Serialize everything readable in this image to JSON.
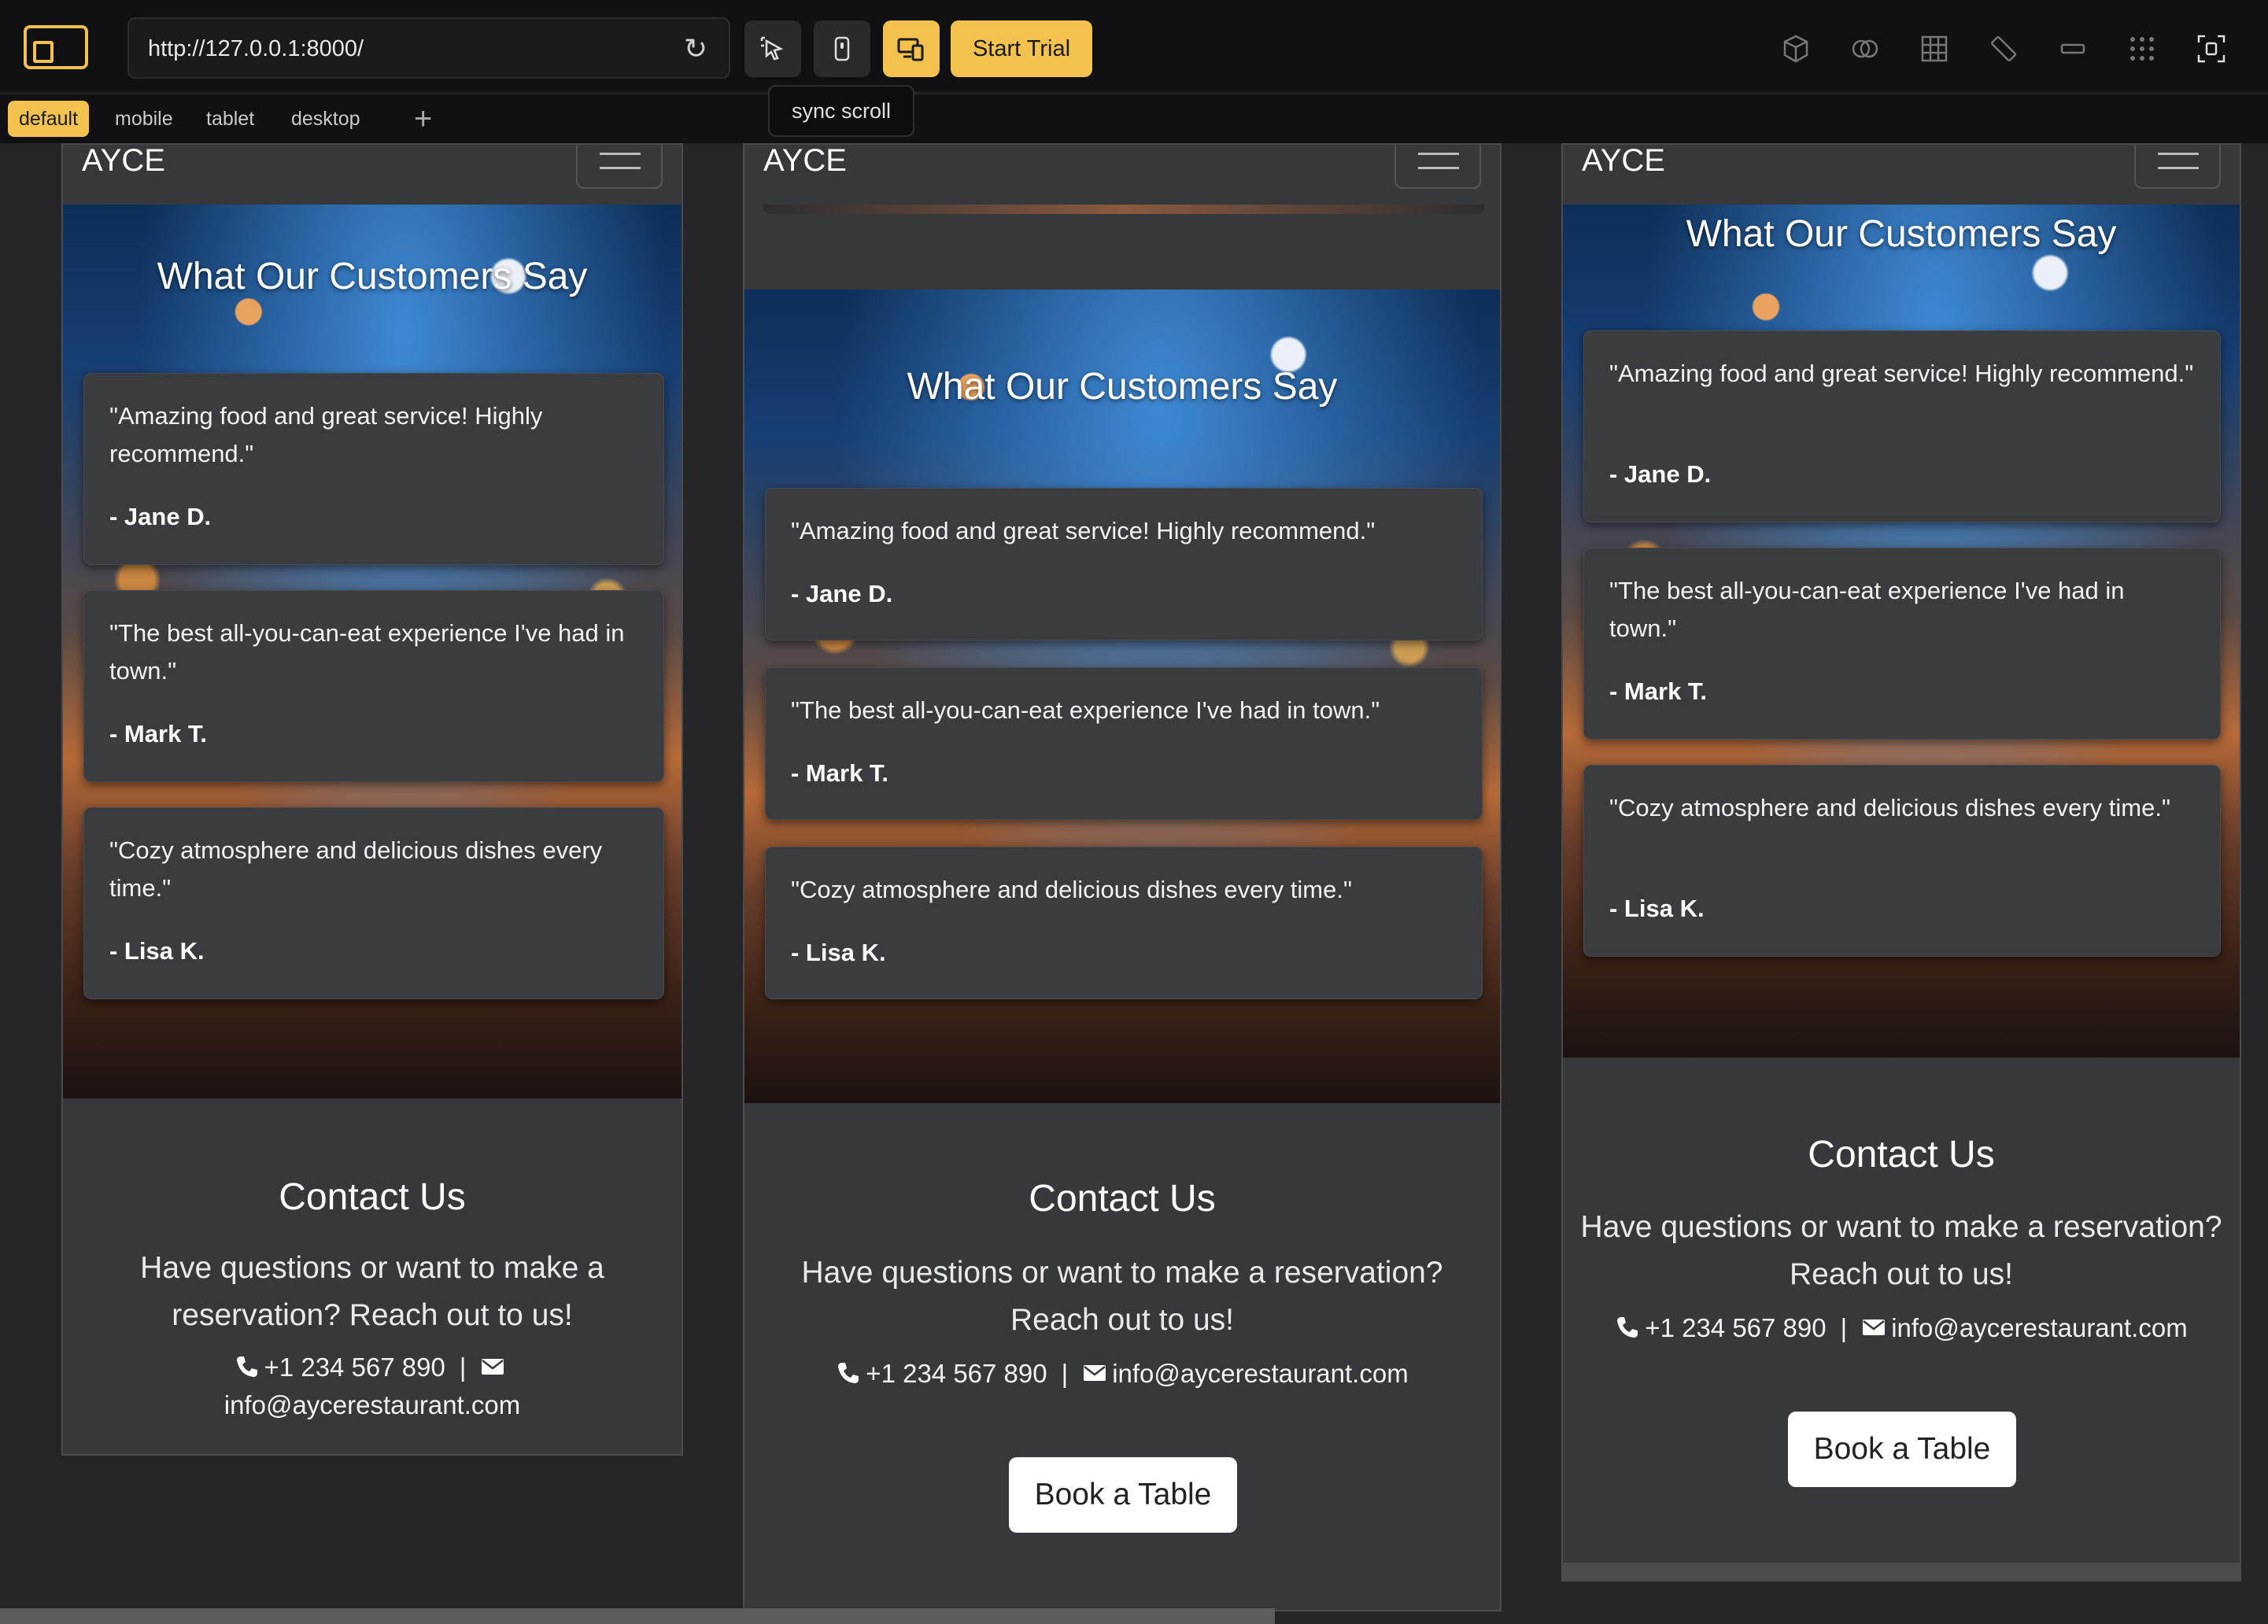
{
  "toolbar": {
    "url": "http://127.0.0.1:8000/",
    "start_trial_label": "Start Trial",
    "tooltip": "sync scroll",
    "icons": [
      "layout-icon",
      "reload-icon",
      "inspect-icon",
      "mobile-icon",
      "responsive-icon",
      "box-icon",
      "layers-icon",
      "grid-icon",
      "ruler-icon",
      "component-icon",
      "dots-grid-icon",
      "screenshot-icon"
    ]
  },
  "tabs": [
    "default",
    "mobile",
    "tablet",
    "desktop"
  ],
  "tabs_add": "+",
  "site": {
    "brand": "AYCE",
    "testimonials_title": "What Our Customers Say",
    "testimonials": [
      {
        "quote": "\"Amazing food and great service! Highly recommend.\"",
        "author": "- Jane D."
      },
      {
        "quote": "\"The best all-you-can-eat experience I've had in town.\"",
        "author": "- Mark T."
      },
      {
        "quote": "\"Cozy atmosphere and delicious dishes every time.\"",
        "author": "- Lisa K."
      }
    ],
    "contact_title": "Contact Us",
    "contact_text": "Have questions or want to make a reservation? Reach out to us!",
    "phone": "+1 234 567 890",
    "separator": "|",
    "email": "info@aycerestaurant.com",
    "book_label": "Book a Table"
  },
  "colors": {
    "accent": "#f2c14e",
    "panel": "#37383b",
    "card": "#3b3c3f",
    "toolbar": "#111113"
  }
}
